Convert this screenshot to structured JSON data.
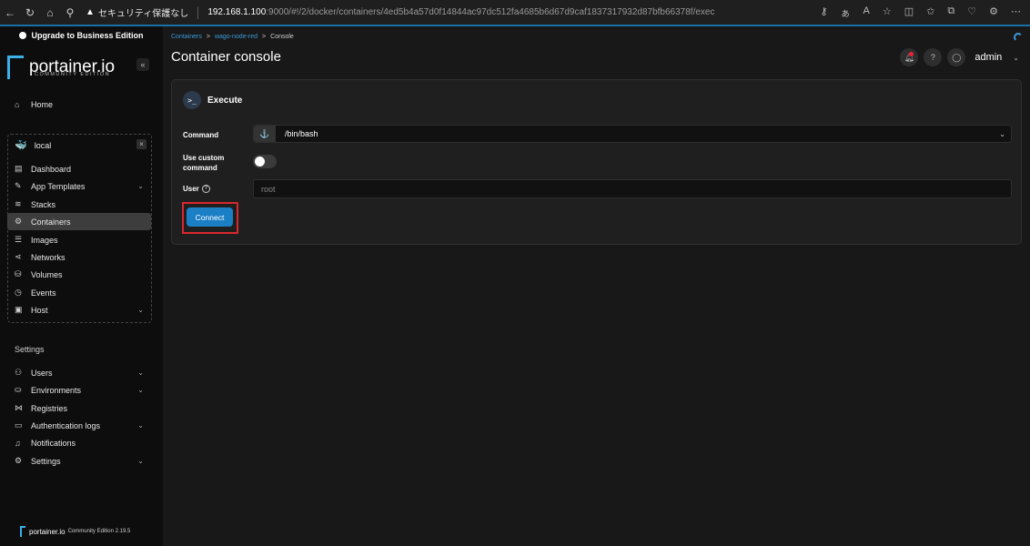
{
  "browser": {
    "warning": "▲",
    "insecure_label": "セキュリティ保護なし",
    "url_host": "192.168.1.100",
    "url_rest": ":9000/#!/2/docker/containers/4ed5b4a57d0f14844ac97dc512fa4685b6d67d9caf1837317932d87bfb66378f/exec"
  },
  "sidebar": {
    "upgrade_label": "Upgrade to Business Edition",
    "logo_text": "portainer.io",
    "logo_sub": "COMMUNITY EDITION",
    "home_label": "Home",
    "environment": {
      "name": "local"
    },
    "env_items": [
      {
        "label": "Dashboard",
        "icon": "dashboard-icon"
      },
      {
        "label": "App Templates",
        "icon": "edit-icon",
        "chevron": true
      },
      {
        "label": "Stacks",
        "icon": "stacks-icon"
      },
      {
        "label": "Containers",
        "icon": "containers-icon",
        "active": true
      },
      {
        "label": "Images",
        "icon": "images-icon"
      },
      {
        "label": "Networks",
        "icon": "networks-icon"
      },
      {
        "label": "Volumes",
        "icon": "volumes-icon"
      },
      {
        "label": "Events",
        "icon": "clock-icon"
      },
      {
        "label": "Host",
        "icon": "host-icon",
        "chevron": true
      }
    ],
    "settings_title": "Settings",
    "settings_items": [
      {
        "label": "Users",
        "icon": "users-icon",
        "chevron": true
      },
      {
        "label": "Environments",
        "icon": "environments-icon",
        "chevron": true
      },
      {
        "label": "Registries",
        "icon": "registries-icon"
      },
      {
        "label": "Authentication logs",
        "icon": "auth-logs-icon",
        "chevron": true
      },
      {
        "label": "Notifications",
        "icon": "bell-icon"
      },
      {
        "label": "Settings",
        "icon": "gear-icon",
        "chevron": true
      }
    ],
    "footer": {
      "name": "portainer.io",
      "edition": "Community Edition",
      "version": "2.19.5"
    }
  },
  "main": {
    "breadcrumb": {
      "root": "Containers",
      "container": "wago-node-red",
      "current": "Console",
      "sep": ">"
    },
    "title": "Container console",
    "user_label": "admin",
    "card": {
      "title": "Execute",
      "command_label": "Command",
      "command_value": "/bin/bash",
      "custom_label_1": "Use custom",
      "custom_label_2": "command",
      "custom_enabled": false,
      "user_label": "User",
      "user_placeholder": "root",
      "connect_label": "Connect"
    }
  },
  "colors": {
    "accent": "#1b7fc6",
    "highlight": "#d9272e",
    "brand": "#3bb0e8"
  }
}
